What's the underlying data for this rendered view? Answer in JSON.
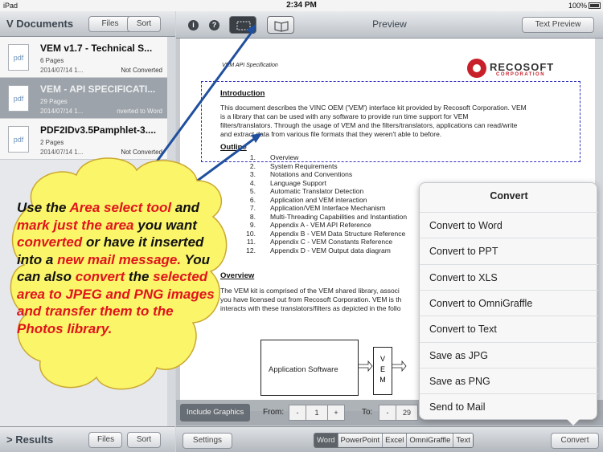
{
  "status_bar": {
    "device": "iPad",
    "time": "2:34 PM",
    "battery": "100%"
  },
  "documents_pane": {
    "title": "Documents",
    "files_label": "Files",
    "sort_label": "Sort",
    "items": [
      {
        "name": "VEM v1.7 - Technical S...",
        "icon": "pdf",
        "pages": "6 Pages",
        "date": "2014/07/14 1...",
        "status": "Not Converted",
        "selected": false
      },
      {
        "name": "VEM - API SPECIFICATI...",
        "icon": "pdf",
        "pages": "29 Pages",
        "date": "2014/07/14 1...",
        "status": "nverted to Word",
        "selected": true
      },
      {
        "name": "PDF2IDv3.5Pamphlet-3....",
        "icon": "pdf",
        "pages": "2 Pages",
        "date": "2014/07/14 1...",
        "status": "Not Converted",
        "selected": false
      }
    ]
  },
  "results_pane": {
    "title": "Results",
    "files_label": "Files",
    "sort_label": "Sort"
  },
  "preview": {
    "title": "Preview",
    "text_preview_label": "Text Preview",
    "info_icon": "i",
    "help_icon": "?",
    "document": {
      "header_left": "VEM API Specification",
      "logo_text": "RECOSOFT",
      "logo_sub": "CORPORATION",
      "intro_heading": "Introduction",
      "intro_lines": [
        "This document describes the VINC OEM ('VEM') interface kit provided by Recosoft Corporation.  VEM",
        "is a library that can be used with any software to provide run time support for VEM",
        "filters/translators.  Through the usage of VEM and the filters/translators, applications can read/write",
        "and extract data from various file formats that they weren't able to before."
      ],
      "outline_heading": "Outline",
      "outline": [
        {
          "num": "1.",
          "text": "Overview"
        },
        {
          "num": "2.",
          "text": "System Requirements"
        },
        {
          "num": "3.",
          "text": "Notations and Conventions"
        },
        {
          "num": "4.",
          "text": "Language Support"
        },
        {
          "num": "5.",
          "text": "Automatic Translator Detection"
        },
        {
          "num": "6.",
          "text": "Application and VEM interaction"
        },
        {
          "num": "7.",
          "text": "Application/VEM Interface Mechanism"
        },
        {
          "num": "8.",
          "text": "Multi-Threading Capabilities and Instantiation"
        },
        {
          "num": "9.",
          "text": "Appendix A - VEM API Reference"
        },
        {
          "num": "10.",
          "text": "Appendix B - VEM Data Structure Reference"
        },
        {
          "num": "11.",
          "text": "Appendix C - VEM Constants Reference"
        },
        {
          "num": "12.",
          "text": "Appendix D - VEM Output data diagram"
        }
      ],
      "overview_heading": "Overview",
      "overview_lines": [
        "The VEM kit is comprised of the VEM shared library, associ",
        "you have licensed out from Recosoft Corporation.  VEM is th",
        "interacts with these translators/filters as depicted in the follo"
      ],
      "diagram_app": "Application Software",
      "diagram_vem": [
        "V",
        "E",
        "M"
      ]
    }
  },
  "range_bar": {
    "include_graphics_label": "Include Graphics",
    "from_label": "From:",
    "from_minus": "-",
    "from_value": "1",
    "from_plus": "+",
    "to_label": "To:",
    "to_minus": "-",
    "to_value": "29"
  },
  "bottom_bar": {
    "settings_label": "Settings",
    "formats": [
      "Word",
      "PowerPoint",
      "Excel",
      "OmniGraffle",
      "Text"
    ],
    "selected_format": "Word",
    "convert_label": "Convert"
  },
  "convert_popover": {
    "title": "Convert",
    "items": [
      "Convert to Word",
      "Convert to PPT",
      "Convert to XLS",
      "Convert to OmniGraffle",
      "Convert to Text",
      "Save as JPG",
      "Save as PNG",
      "Send to Mail"
    ]
  },
  "callout": {
    "segments": [
      {
        "text": "Use the ",
        "highlight": false
      },
      {
        "text": "Area select tool",
        "highlight": true
      },
      {
        "text": " and ",
        "highlight": false
      },
      {
        "text": "mark just the area",
        "highlight": true
      },
      {
        "text": " you want ",
        "highlight": false
      },
      {
        "text": "converted",
        "highlight": true
      },
      {
        "text": " or have it inserted into a ",
        "highlight": false
      },
      {
        "text": "new mail message.",
        "highlight": true
      },
      {
        "text": " You can also ",
        "highlight": false
      },
      {
        "text": "convert",
        "highlight": true
      },
      {
        "text": " the ",
        "highlight": false
      },
      {
        "text": "selected area to JPEG and PNG images and transfer them to the Photos library.",
        "highlight": true
      }
    ]
  },
  "colors": {
    "callout_fill": "#fbf56a",
    "highlight": "#e0141c",
    "arrow": "#1f4f9e",
    "selection": "#3030c0"
  }
}
